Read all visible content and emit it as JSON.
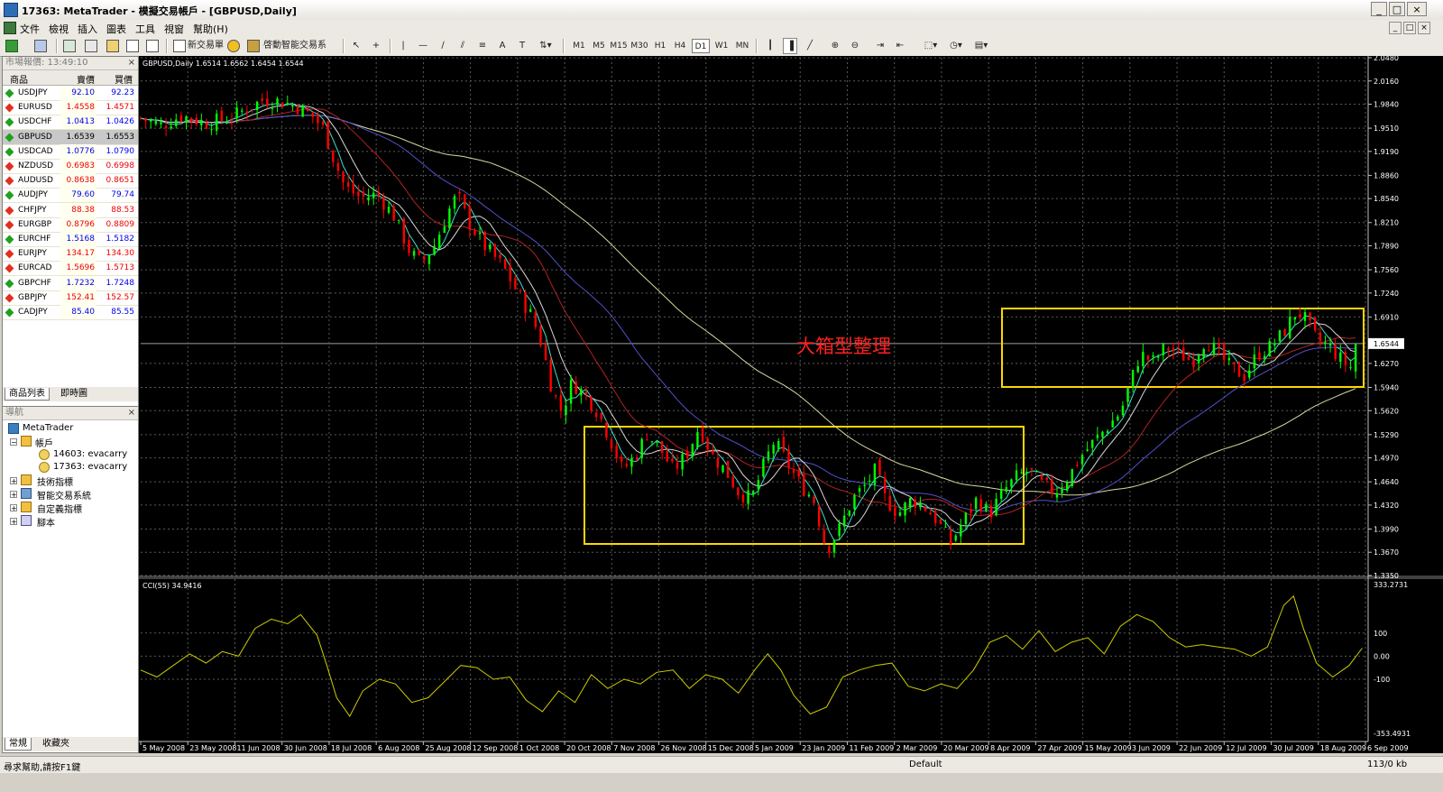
{
  "window": {
    "title": "17363: MetaTrader - 模擬交易帳戶 - [GBPUSD,Daily]",
    "buttons": [
      "_",
      "□",
      "×"
    ]
  },
  "menu": {
    "items": [
      "文件",
      "檢視",
      "插入",
      "圖表",
      "工具",
      "視窗",
      "幫助(H)"
    ],
    "mdi_buttons": [
      "_",
      "□",
      "×"
    ]
  },
  "toolbar": {
    "new_order": "新交易單",
    "expert_advisors": "啓動智能交易系統",
    "timeframes": [
      "M1",
      "M5",
      "M15",
      "M30",
      "H1",
      "H4",
      "D1",
      "W1",
      "MN"
    ],
    "active_timeframe": "D1"
  },
  "market_watch": {
    "title": "市場報價: 13:49:10",
    "columns": [
      "商品",
      "賣價",
      "買價"
    ],
    "rows": [
      {
        "symbol": "USDJPY",
        "bid": "92.10",
        "ask": "92.23",
        "color": "#0000ee"
      },
      {
        "symbol": "EURUSD",
        "bid": "1.4558",
        "ask": "1.4571",
        "color": "#ee0000"
      },
      {
        "symbol": "USDCHF",
        "bid": "1.0413",
        "ask": "1.0426",
        "color": "#0000ee"
      },
      {
        "symbol": "GBPUSD",
        "bid": "1.6539",
        "ask": "1.6553",
        "color": "#000000"
      },
      {
        "symbol": "USDCAD",
        "bid": "1.0776",
        "ask": "1.0790",
        "color": "#0000ee"
      },
      {
        "symbol": "NZDUSD",
        "bid": "0.6983",
        "ask": "0.6998",
        "color": "#ee0000"
      },
      {
        "symbol": "AUDUSD",
        "bid": "0.8638",
        "ask": "0.8651",
        "color": "#ee0000"
      },
      {
        "symbol": "AUDJPY",
        "bid": "79.60",
        "ask": "79.74",
        "color": "#0000ee"
      },
      {
        "symbol": "CHFJPY",
        "bid": "88.38",
        "ask": "88.53",
        "color": "#ee0000"
      },
      {
        "symbol": "EURGBP",
        "bid": "0.8796",
        "ask": "0.8809",
        "color": "#ee0000"
      },
      {
        "symbol": "EURCHF",
        "bid": "1.5168",
        "ask": "1.5182",
        "color": "#0000ee"
      },
      {
        "symbol": "EURJPY",
        "bid": "134.17",
        "ask": "134.30",
        "color": "#ee0000"
      },
      {
        "symbol": "EURCAD",
        "bid": "1.5696",
        "ask": "1.5713",
        "color": "#ee0000"
      },
      {
        "symbol": "GBPCHF",
        "bid": "1.7232",
        "ask": "1.7248",
        "color": "#0000ee"
      },
      {
        "symbol": "GBPJPY",
        "bid": "152.41",
        "ask": "152.57",
        "color": "#ee0000"
      },
      {
        "symbol": "CADJPY",
        "bid": "85.40",
        "ask": "85.55",
        "color": "#0000ee"
      }
    ],
    "tabs": [
      "商品列表",
      "即時圖"
    ]
  },
  "navigator": {
    "title": "導航",
    "root": "MetaTrader",
    "accounts_label": "帳戶",
    "accounts": [
      "14603: evacarry",
      "17363: evacarry"
    ],
    "groups": [
      "技術指標",
      "智能交易系統",
      "自定義指標",
      "腳本"
    ],
    "tabs": [
      "常規",
      "收藏夾"
    ]
  },
  "chart": {
    "header": "GBPUSD,Daily  1.6514 1.6562 1.6454 1.6544",
    "current_price": "1.6544",
    "annotation": "大箱型整理",
    "indicator_header": "CCI(55) 34.9416",
    "cci_top_label": "333.2731",
    "cci_bottom_label": "-353.4931",
    "cci_levels": [
      "100",
      "0.00",
      "-100"
    ],
    "colors": {
      "bull": "#00ff00",
      "bear": "#ff0000",
      "box": "#ffd700",
      "cci": "#cccc00",
      "ma_fast": "#40e0d0",
      "ma_mid": "#d8d8d8",
      "ma_red": "#b22222",
      "ma_blue": "#5050c8",
      "ma_long": "#d8d8a0",
      "annotation": "#ff2020"
    }
  },
  "chart_data": {
    "type": "candlestick",
    "symbol": "GBPUSD",
    "timeframe": "Daily",
    "y_ticks": [
      "2.0480",
      "2.0160",
      "1.9840",
      "1.9510",
      "1.9190",
      "1.8860",
      "1.8540",
      "1.8210",
      "1.7890",
      "1.7560",
      "1.7240",
      "1.6910",
      "1.6270",
      "1.5940",
      "1.5620",
      "1.5290",
      "1.4970",
      "1.4640",
      "1.4320",
      "1.3990",
      "1.3670",
      "1.3350"
    ],
    "ylim": [
      1.335,
      2.048
    ],
    "x_ticks": [
      "5 May 2008",
      "23 May 2008",
      "11 Jun 2008",
      "30 Jun 2008",
      "18 Jul 2008",
      "6 Aug 2008",
      "25 Aug 2008",
      "12 Sep 2008",
      "1 Oct 2008",
      "20 Oct 2008",
      "7 Nov 2008",
      "26 Nov 2008",
      "15 Dec 2008",
      "5 Jan 2009",
      "23 Jan 2009",
      "11 Feb 2009",
      "2 Mar 2009",
      "20 Mar 2009",
      "8 Apr 2009",
      "27 Apr 2009",
      "15 May 2009",
      "3 Jun 2009",
      "22 Jun 2009",
      "12 Jul 2009",
      "30 Jul 2009",
      "18 Aug 2009",
      "6 Sep 2009"
    ],
    "close_path": [
      [
        0,
        1.965
      ],
      [
        12,
        1.955
      ],
      [
        25,
        1.968
      ],
      [
        40,
        1.958
      ],
      [
        55,
        1.965
      ],
      [
        65,
        1.978
      ],
      [
        75,
        1.99
      ],
      [
        85,
        1.988
      ],
      [
        95,
        1.982
      ],
      [
        105,
        1.968
      ],
      [
        112,
        1.95
      ],
      [
        118,
        1.91
      ],
      [
        125,
        1.87
      ],
      [
        135,
        1.855
      ],
      [
        145,
        1.86
      ],
      [
        155,
        1.83
      ],
      [
        165,
        1.78
      ],
      [
        172,
        1.765
      ],
      [
        180,
        1.79
      ],
      [
        188,
        1.835
      ],
      [
        194,
        1.86
      ],
      [
        200,
        1.825
      ],
      [
        210,
        1.79
      ],
      [
        222,
        1.76
      ],
      [
        232,
        1.72
      ],
      [
        240,
        1.69
      ],
      [
        246,
        1.65
      ],
      [
        252,
        1.59
      ],
      [
        258,
        1.56
      ],
      [
        264,
        1.6
      ],
      [
        272,
        1.585
      ],
      [
        280,
        1.56
      ],
      [
        288,
        1.52
      ],
      [
        295,
        1.48
      ],
      [
        303,
        1.5
      ],
      [
        310,
        1.53
      ],
      [
        318,
        1.51
      ],
      [
        326,
        1.48
      ],
      [
        334,
        1.5
      ],
      [
        342,
        1.54
      ],
      [
        350,
        1.5
      ],
      [
        358,
        1.48
      ],
      [
        366,
        1.45
      ],
      [
        374,
        1.44
      ],
      [
        382,
        1.49
      ],
      [
        388,
        1.52
      ],
      [
        396,
        1.49
      ],
      [
        404,
        1.46
      ],
      [
        412,
        1.44
      ],
      [
        420,
        1.37
      ],
      [
        428,
        1.4
      ],
      [
        436,
        1.44
      ],
      [
        444,
        1.46
      ],
      [
        450,
        1.48
      ],
      [
        456,
        1.44
      ],
      [
        464,
        1.42
      ],
      [
        472,
        1.44
      ],
      [
        480,
        1.43
      ],
      [
        488,
        1.41
      ],
      [
        496,
        1.38
      ],
      [
        504,
        1.41
      ],
      [
        512,
        1.44
      ],
      [
        520,
        1.42
      ],
      [
        528,
        1.45
      ],
      [
        536,
        1.47
      ],
      [
        544,
        1.48
      ],
      [
        552,
        1.46
      ],
      [
        560,
        1.45
      ],
      [
        568,
        1.47
      ],
      [
        576,
        1.5
      ],
      [
        584,
        1.52
      ],
      [
        592,
        1.54
      ],
      [
        600,
        1.56
      ],
      [
        606,
        1.6
      ],
      [
        612,
        1.64
      ],
      [
        620,
        1.63
      ],
      [
        628,
        1.65
      ],
      [
        636,
        1.64
      ],
      [
        644,
        1.63
      ],
      [
        652,
        1.66
      ],
      [
        660,
        1.64
      ],
      [
        668,
        1.62
      ],
      [
        676,
        1.61
      ],
      [
        684,
        1.64
      ],
      [
        692,
        1.65
      ],
      [
        700,
        1.67
      ],
      [
        708,
        1.7
      ],
      [
        714,
        1.685
      ],
      [
        720,
        1.66
      ],
      [
        728,
        1.65
      ],
      [
        736,
        1.63
      ],
      [
        742,
        1.62
      ],
      [
        748,
        1.6544
      ]
    ],
    "cci_path": [
      [
        0,
        -60
      ],
      [
        10,
        -90
      ],
      [
        20,
        -40
      ],
      [
        30,
        10
      ],
      [
        40,
        -30
      ],
      [
        50,
        20
      ],
      [
        60,
        0
      ],
      [
        70,
        120
      ],
      [
        80,
        160
      ],
      [
        90,
        140
      ],
      [
        98,
        180
      ],
      [
        108,
        90
      ],
      [
        114,
        -40
      ],
      [
        120,
        -180
      ],
      [
        128,
        -260
      ],
      [
        136,
        -150
      ],
      [
        146,
        -100
      ],
      [
        156,
        -120
      ],
      [
        166,
        -200
      ],
      [
        176,
        -180
      ],
      [
        186,
        -110
      ],
      [
        196,
        -40
      ],
      [
        206,
        -50
      ],
      [
        216,
        -100
      ],
      [
        226,
        -90
      ],
      [
        236,
        -190
      ],
      [
        246,
        -240
      ],
      [
        256,
        -150
      ],
      [
        266,
        -200
      ],
      [
        276,
        -80
      ],
      [
        286,
        -140
      ],
      [
        296,
        -100
      ],
      [
        306,
        -120
      ],
      [
        316,
        -70
      ],
      [
        326,
        -60
      ],
      [
        336,
        -140
      ],
      [
        346,
        -80
      ],
      [
        356,
        -100
      ],
      [
        366,
        -160
      ],
      [
        376,
        -60
      ],
      [
        384,
        10
      ],
      [
        392,
        -60
      ],
      [
        400,
        -170
      ],
      [
        410,
        -250
      ],
      [
        420,
        -220
      ],
      [
        430,
        -90
      ],
      [
        440,
        -60
      ],
      [
        450,
        -40
      ],
      [
        460,
        -30
      ],
      [
        470,
        -130
      ],
      [
        480,
        -150
      ],
      [
        490,
        -120
      ],
      [
        500,
        -140
      ],
      [
        510,
        -60
      ],
      [
        520,
        60
      ],
      [
        530,
        90
      ],
      [
        540,
        30
      ],
      [
        550,
        110
      ],
      [
        560,
        20
      ],
      [
        570,
        60
      ],
      [
        580,
        80
      ],
      [
        590,
        10
      ],
      [
        600,
        130
      ],
      [
        610,
        180
      ],
      [
        620,
        150
      ],
      [
        630,
        80
      ],
      [
        640,
        40
      ],
      [
        650,
        50
      ],
      [
        660,
        40
      ],
      [
        670,
        30
      ],
      [
        680,
        0
      ],
      [
        690,
        40
      ],
      [
        700,
        220
      ],
      [
        706,
        260
      ],
      [
        712,
        120
      ],
      [
        720,
        -30
      ],
      [
        730,
        -90
      ],
      [
        740,
        -40
      ],
      [
        748,
        34.94
      ]
    ]
  },
  "status": {
    "help": "尋求幫助,請按F1鍵",
    "profile": "Default",
    "traffic": "113/0 kb"
  }
}
